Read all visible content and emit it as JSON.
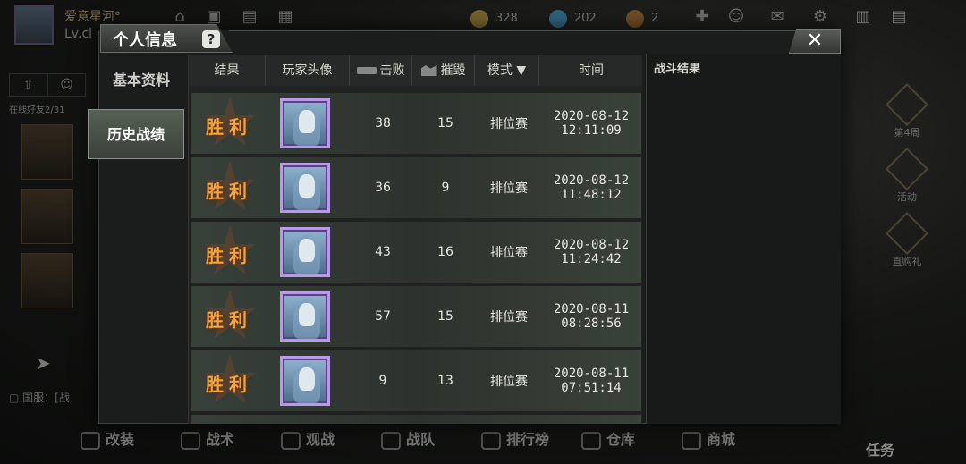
{
  "hud": {
    "player_name": "爱意星河°",
    "player_level": "Lv.cl",
    "gold": "328",
    "diamond": "202",
    "medal": "2",
    "friends_tab_icon": "upload-icon",
    "friend_online": "在线好友2/31",
    "chat_channel": "国服：[战",
    "right_items": [
      "第4周",
      "活动",
      "直购礼"
    ],
    "bottom_nav": [
      "改装",
      "战术",
      "观战",
      "战队",
      "排行榜",
      "仓库",
      "商城"
    ],
    "task": "任务"
  },
  "dialog": {
    "title": "个人信息",
    "help": "?",
    "close": "✕",
    "sidebar": [
      "基本资料",
      "历史战绩"
    ],
    "active_sidebar": "历史战绩",
    "columns": {
      "result": "结果",
      "avatar": "玩家头像",
      "kills": "击败",
      "destroy": "摧毁",
      "mode": "模式",
      "mode_arrow": "▼",
      "time": "时间"
    },
    "rows": [
      {
        "result": "胜利",
        "kills": "38",
        "destroy": "15",
        "mode": "排位赛",
        "date": "2020-08-12",
        "time": "12:11:09"
      },
      {
        "result": "胜利",
        "kills": "36",
        "destroy": "9",
        "mode": "排位赛",
        "date": "2020-08-12",
        "time": "11:48:12"
      },
      {
        "result": "胜利",
        "kills": "43",
        "destroy": "16",
        "mode": "排位赛",
        "date": "2020-08-12",
        "time": "11:24:42"
      },
      {
        "result": "胜利",
        "kills": "57",
        "destroy": "15",
        "mode": "排位赛",
        "date": "2020-08-11",
        "time": "08:28:56"
      },
      {
        "result": "胜利",
        "kills": "9",
        "destroy": "13",
        "mode": "排位赛",
        "date": "2020-08-11",
        "time": "07:51:14"
      }
    ],
    "right_panel_title": "战斗结果"
  },
  "colors": {
    "win": "#f2a43c",
    "avatar_frame": "#b99ae6",
    "row_bg": "#2c322d"
  }
}
